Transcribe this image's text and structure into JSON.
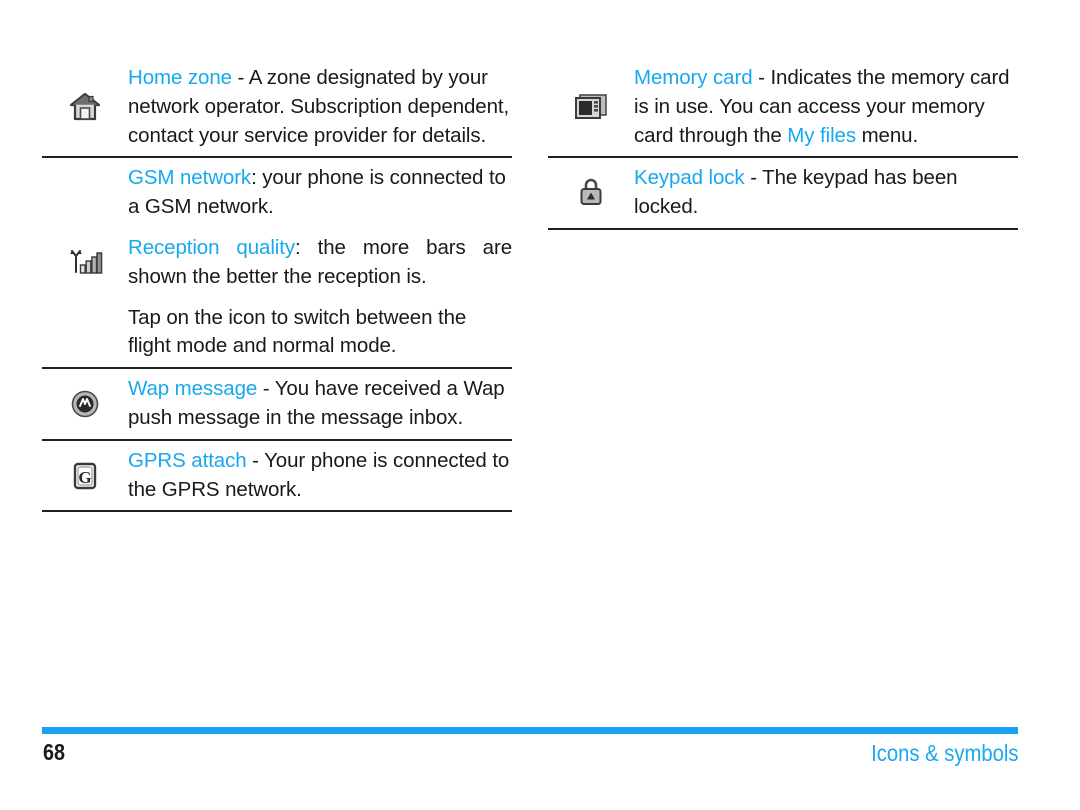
{
  "document": {
    "page_number": "68",
    "section_title": "Icons & symbols",
    "accent_color": "#18a8ef",
    "rule_color": "#231f20"
  },
  "left_column": {
    "entries": [
      {
        "icon": "home-zone-icon",
        "term": "Home zone",
        "separator": " - ",
        "description": "A zone designated by your network operator. Subscription dependent, contact your service provider for details.",
        "rule_below": true
      },
      {
        "icon": null,
        "term": "GSM network",
        "separator": ": ",
        "description": "your phone is connected to a GSM network.",
        "rule_below": false
      },
      {
        "icon": "reception-quality-icon",
        "term": "Reception quality",
        "separator": ": ",
        "description": "the more bars are shown the better the reception is.",
        "justified": true,
        "line1": "Reception quality: the more bars are",
        "line2": "shown the better the reception is.",
        "extra_paragraph": "Tap on the icon to switch between the flight mode and normal mode.",
        "rule_below": true
      },
      {
        "icon": "wap-message-icon",
        "term": "Wap message",
        "separator": " - ",
        "description": "You have received a Wap push message in the message inbox.",
        "rule_below": true
      },
      {
        "icon": "gprs-attach-icon",
        "term": "GPRS attach",
        "separator": " - ",
        "description": "Your phone is connected to the GPRS network.",
        "rule_below": true
      }
    ]
  },
  "right_column": {
    "entries": [
      {
        "icon": "memory-card-icon",
        "term": "Memory card",
        "separator": " - ",
        "description_part1": "Indicates the memory card is in use. You can access your memory card through the ",
        "inline_term": "My files",
        "description_part2": " menu.",
        "rule_below": true
      },
      {
        "icon": "keypad-lock-icon",
        "term": "Keypad lock",
        "separator": " - ",
        "description": "The keypad has been locked.",
        "rule_below": true
      }
    ]
  }
}
